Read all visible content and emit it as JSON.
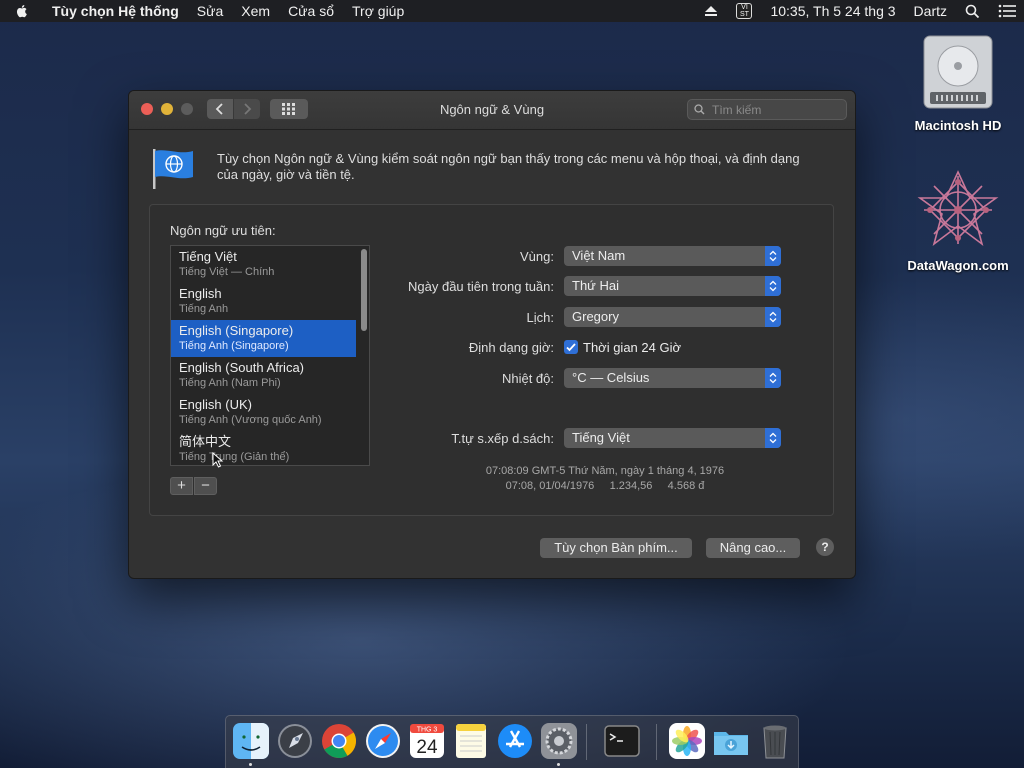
{
  "menubar": {
    "app_name": "Tùy chọn Hệ thống",
    "items": [
      "Sửa",
      "Xem",
      "Cửa sổ",
      "Trợ giúp"
    ],
    "input_source": "VI ST",
    "clock": "10:35, Th 5 24 thg 3",
    "user": "Dartz"
  },
  "desktop": {
    "icons": [
      {
        "label": "Macintosh HD",
        "icon": "hard-drive-icon"
      },
      {
        "label": "DataWagon.com",
        "icon": "datawagon-logo-icon"
      }
    ]
  },
  "window": {
    "title": "Ngôn ngữ & Vùng",
    "search_placeholder": "Tìm kiếm",
    "description": "Tùy chọn Ngôn ngữ & Vùng kiểm soát ngôn ngữ bạn thấy trong các menu và hộp thoại, và định dạng của ngày, giờ và tiền tệ.",
    "preferred_languages_label": "Ngôn ngữ ưu tiên:",
    "languages": [
      {
        "name": "Tiếng Việt",
        "sub": "Tiếng Việt — Chính",
        "selected": false
      },
      {
        "name": "English",
        "sub": "Tiếng Anh",
        "selected": false
      },
      {
        "name": "English (Singapore)",
        "sub": "Tiếng Anh (Singapore)",
        "selected": true
      },
      {
        "name": "English (South Africa)",
        "sub": "Tiếng Anh (Nam Phi)",
        "selected": false
      },
      {
        "name": "English (UK)",
        "sub": "Tiếng Anh (Vương quốc Anh)",
        "selected": false
      },
      {
        "name": "简体中文",
        "sub": "Tiếng Trung (Giản thể)",
        "selected": false
      }
    ],
    "add_label": "+",
    "remove_label": "−",
    "region": {
      "label": "Vùng:",
      "value": "Việt Nam"
    },
    "first_day": {
      "label": "Ngày đầu tiên trong tuần:",
      "value": "Thứ Hai"
    },
    "calendar": {
      "label": "Lịch:",
      "value": "Gregory"
    },
    "time_format": {
      "label": "Định dạng giờ:",
      "checkbox_label": "Thời gian 24 Giờ",
      "checked": true
    },
    "temperature": {
      "label": "Nhiệt độ:",
      "value": "°C — Celsius"
    },
    "list_sort": {
      "label": "T.tự s.xếp d.sách:",
      "value": "Tiếng Việt"
    },
    "sample_line1": "07:08:09 GMT-5 Thứ Năm, ngày 1 tháng 4, 1976",
    "sample_line2": "07:08, 01/04/1976     1.234,56     4.568 đ",
    "keyboard_button": "Tùy chọn Bàn phím...",
    "advanced_button": "Nâng cao...",
    "help_label": "?"
  },
  "dock": {
    "calendar_month": "THG 3",
    "calendar_day": "24",
    "apps": [
      "finder-icon",
      "launchpad-icon",
      "chrome-icon",
      "safari-icon",
      "calendar-icon",
      "notes-icon",
      "app-store-icon",
      "system-preferences-icon",
      "terminal-icon",
      "photos-icon",
      "downloads-folder-icon",
      "trash-icon"
    ]
  }
}
